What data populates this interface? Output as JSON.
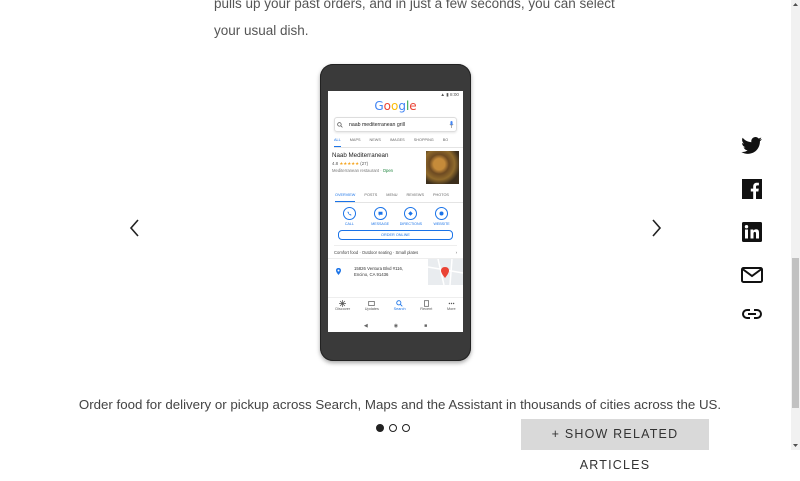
{
  "article": {
    "top_lines": [
      "pulls up your past orders, and in just a few seconds, you can select",
      "your usual dish."
    ],
    "caption": "Order food for delivery or pickup across Search, Maps and the Assistant in thousands of cities across the US."
  },
  "phone": {
    "status_time": "8:00",
    "logo": "Google",
    "query": "naab mediterranean grill",
    "search_tabs": [
      "ALL",
      "MAPS",
      "NEWS",
      "IMAGES",
      "SHOPPING",
      "BO"
    ],
    "business": {
      "name": "Naab Mediterranean",
      "rating": "4.8",
      "stars": "★★★★★",
      "reviews": "(27)",
      "category": "Mediterranean restaurant",
      "status": "Open"
    },
    "place_tabs": [
      "OVERVIEW",
      "POSTS",
      "MENU",
      "REVIEWS",
      "PHOTOS"
    ],
    "actions": [
      "CALL",
      "MESSAGE",
      "DIRECTIONS",
      "WEBSITE"
    ],
    "order_button": "ORDER ONLINE",
    "tags": "Comfort food · Outdoor seating · Small plates",
    "address_line1": "15826 Ventura Blvd #116,",
    "address_line2": "Encino, CA 91436",
    "bottom_nav": [
      "Discover",
      "Updates",
      "Search",
      "Recent",
      "More"
    ]
  },
  "carousel": {
    "dots": 3,
    "active_index": 0
  },
  "related_button": "+ SHOW RELATED ARTICLES",
  "share": [
    "twitter-icon",
    "facebook-icon",
    "linkedin-icon",
    "mail-icon",
    "link-icon"
  ],
  "colors": {
    "accent": "#1a73e8",
    "related_bg": "#d9d9d9",
    "phone_body": "#3a3a3a"
  }
}
